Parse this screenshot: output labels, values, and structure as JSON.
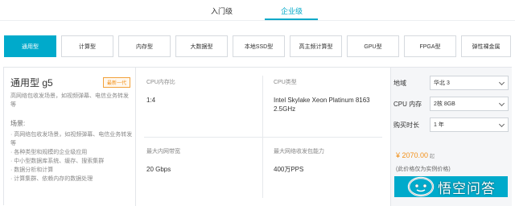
{
  "tiers": [
    {
      "label": "入门级",
      "active": false
    },
    {
      "label": "企业级",
      "active": true
    }
  ],
  "categories": [
    {
      "label": "通用型",
      "active": true
    },
    {
      "label": "计算型",
      "active": false
    },
    {
      "label": "内存型",
      "active": false
    },
    {
      "label": "大数据型",
      "active": false
    },
    {
      "label": "本地SSD型",
      "active": false
    },
    {
      "label": "高主频计算型",
      "active": false
    },
    {
      "label": "GPU型",
      "active": false
    },
    {
      "label": "FPGA型",
      "active": false
    },
    {
      "label": "弹性裸金属",
      "active": false
    }
  ],
  "instance": {
    "title": "通用型 g5",
    "badge": "最新一代",
    "description": "高网络包收发场景，如视频弹幕、电信业务转发等",
    "scenarios_label": "场景:",
    "scenarios": [
      "· 高网络包收发场景，如视频弹幕、电信业务转发等",
      "· 各种类型和规模的企业级应用",
      "· 中小型数据库系统、缓存、搜索集群",
      "· 数据分析和计算",
      "· 计算集群、依赖内存的数据处理"
    ]
  },
  "specs": {
    "cpu_mem_ratio_label": "CPU内存比",
    "cpu_mem_ratio": "1:4",
    "cpu_type_label": "CPU类型",
    "cpu_type": "Intel Skylake Xeon Platinum 8163 2.5GHz",
    "max_bandwidth_label": "最大内网带宽",
    "max_bandwidth": "20 Gbps",
    "max_pps_label": "最大网络收发包能力",
    "max_pps": "400万PPS"
  },
  "config": {
    "region_label": "地域",
    "region": "华北 3",
    "cpu_mem_label": "CPU 内存",
    "cpu_mem": "2核 8GB",
    "duration_label": "购买时长",
    "duration": "1 年",
    "price": "¥ 2070.00",
    "price_unit": "起",
    "price_note": "(此价格仅为实例价格)"
  },
  "watermark": {
    "text": "悟空问答"
  },
  "colors": {
    "accent": "#00aacb",
    "price": "#f29018",
    "badge": "#f29018"
  }
}
